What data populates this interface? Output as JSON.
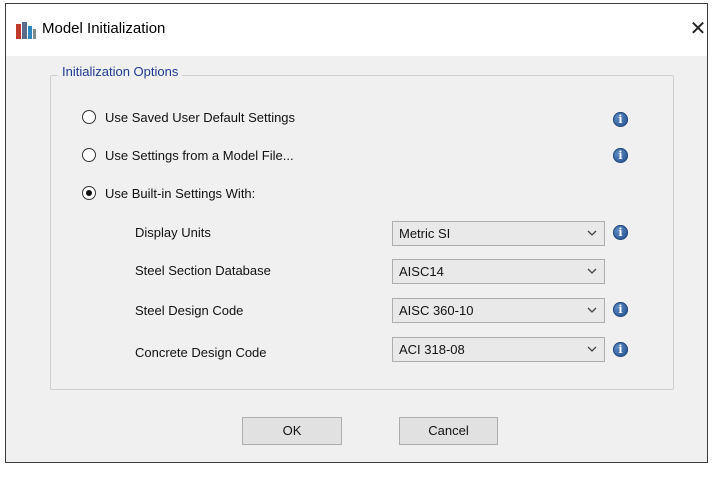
{
  "window": {
    "title": "Model Initialization",
    "icon": "etabs-app-icon",
    "close_icon": "close-icon"
  },
  "group": {
    "label": "Initialization Options"
  },
  "options": [
    {
      "label": "Use Saved User Default Settings",
      "checked": false
    },
    {
      "label": "Use Settings from a Model File...",
      "checked": false
    },
    {
      "label": "Use Built-in Settings With:",
      "checked": true
    }
  ],
  "fields": [
    {
      "label": "Display Units",
      "value": "Metric SI"
    },
    {
      "label": "Steel Section Database",
      "value": "AISC14"
    },
    {
      "label": "Steel Design Code",
      "value": "AISC 360-10"
    },
    {
      "label": "Concrete Design Code",
      "value": "ACI 318-08"
    }
  ],
  "info_glyph": "i",
  "buttons": {
    "ok": "OK",
    "cancel": "Cancel"
  },
  "colors": {
    "group_label": "#1f3a93",
    "info_icon": "#2f5d9a",
    "dialog_bg": "#f0f0f0"
  }
}
